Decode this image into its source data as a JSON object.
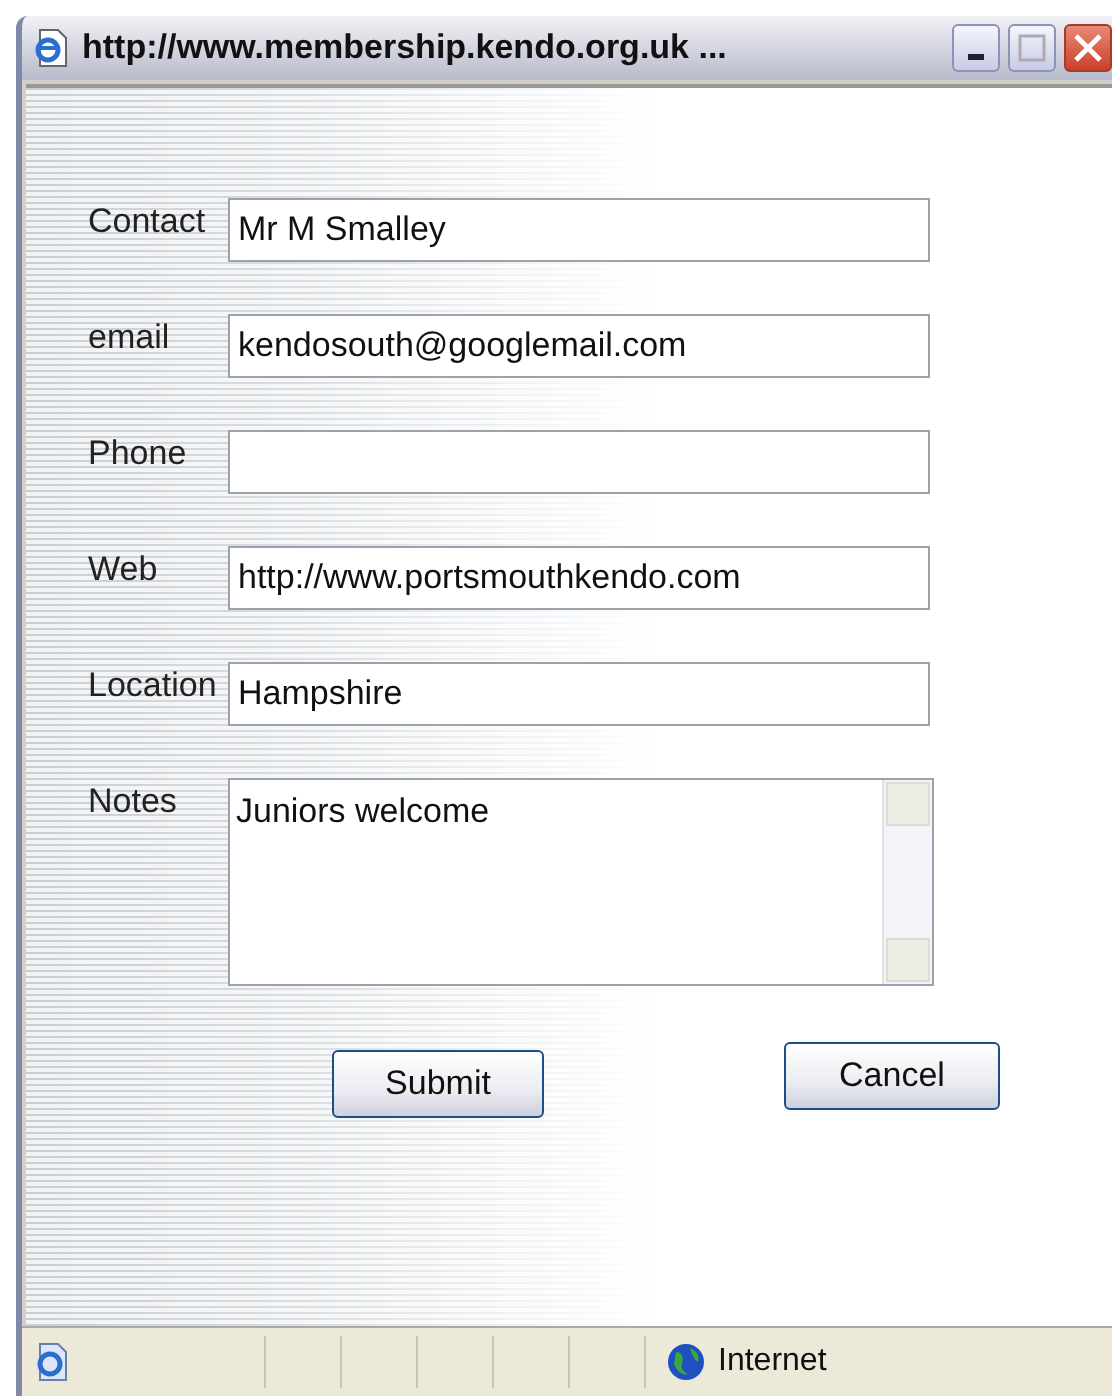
{
  "window": {
    "title": "http://www.membership.kendo.org.uk ..."
  },
  "fields": [
    {
      "kind": "text",
      "label": "Contact",
      "value": "Mr M Smalley"
    },
    {
      "kind": "text",
      "label": "email",
      "value": "kendosouth@googlemail.com"
    },
    {
      "kind": "text",
      "label": "Phone"
    },
    {
      "kind": "text",
      "label": "Web",
      "value": "http://www.portsmouthkendo.com"
    },
    {
      "kind": "text",
      "label": "Location",
      "value": "Hampshire"
    },
    {
      "kind": "textarea",
      "label": "Notes",
      "value": "Juniors welcome"
    }
  ],
  "buttons": [
    "Submit",
    "Cancel"
  ],
  "status_bar": {
    "zone": "Internet"
  }
}
